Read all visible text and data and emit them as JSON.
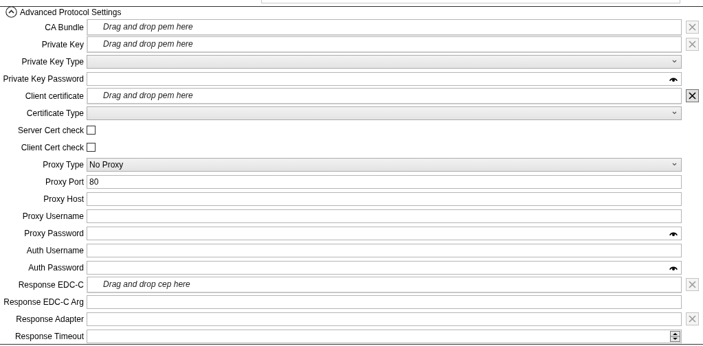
{
  "section": {
    "title": "Advanced Protocol Settings",
    "expanded": true
  },
  "fields": [
    {
      "label": "CA Bundle",
      "kind": "drop",
      "placeholder": "Drag and drop pem here",
      "clear": {
        "disabled": true
      }
    },
    {
      "label": "Private Key",
      "kind": "drop",
      "placeholder": "Drag and drop pem here",
      "clear": {
        "disabled": true
      }
    },
    {
      "label": "Private Key Type",
      "kind": "select"
    },
    {
      "label": "Private Key Password",
      "kind": "password"
    },
    {
      "label": "Client certificate",
      "kind": "drop",
      "placeholder": "Drag and drop pem here",
      "clear": {
        "disabled": false
      }
    },
    {
      "label": "Certificate Type",
      "kind": "select"
    },
    {
      "label": "Server Cert check",
      "kind": "checkbox",
      "checked": false
    },
    {
      "label": "Client Cert check",
      "kind": "checkbox",
      "checked": false
    },
    {
      "label": "Proxy Type",
      "kind": "select",
      "value": "No Proxy"
    },
    {
      "label": "Proxy Port",
      "kind": "text",
      "value": "80"
    },
    {
      "label": "Proxy Host",
      "kind": "text"
    },
    {
      "label": "Proxy Username",
      "kind": "text"
    },
    {
      "label": "Proxy Password",
      "kind": "password"
    },
    {
      "label": "Auth Username",
      "kind": "text"
    },
    {
      "label": "Auth Password",
      "kind": "password"
    },
    {
      "label": "Response EDC-C",
      "kind": "drop",
      "placeholder": "Drag and drop cep here",
      "clear": {
        "disabled": true
      }
    },
    {
      "label": "Response EDC-C Arg",
      "kind": "text"
    },
    {
      "label": "Response Adapter",
      "kind": "text",
      "clear": {
        "disabled": true
      }
    },
    {
      "label": "Response Timeout",
      "kind": "spinner"
    }
  ]
}
